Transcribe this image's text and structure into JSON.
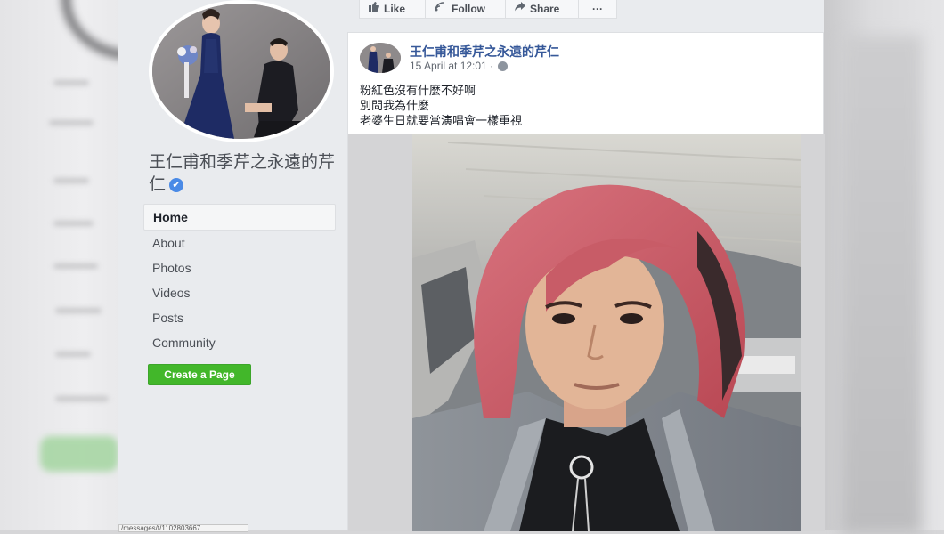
{
  "page": {
    "name": "王仁甫和季芹之永遠的芹仁",
    "verified": true
  },
  "nav": {
    "items": [
      {
        "label": "Home",
        "active": true
      },
      {
        "label": "About",
        "active": false
      },
      {
        "label": "Photos",
        "active": false
      },
      {
        "label": "Videos",
        "active": false
      },
      {
        "label": "Posts",
        "active": false
      },
      {
        "label": "Community",
        "active": false
      }
    ],
    "create_page_label": "Create a Page"
  },
  "actions": {
    "like_label": "Like",
    "follow_label": "Follow",
    "share_label": "Share",
    "more_label": "···"
  },
  "post": {
    "author": "王仁甫和季芹之永遠的芹仁",
    "timestamp": "15 April at 12:01 ·",
    "lines": [
      "粉紅色沒有什麼不好啊",
      "別問我為什麼",
      "老婆生日就要當演唱會一樣重視"
    ]
  },
  "status_bar": {
    "url": "/messages/t/1102803667"
  },
  "colors": {
    "link": "#365899",
    "create_button": "#42b72a",
    "verified": "#4a8ae6",
    "sidebar_bg": "#e9ebee"
  },
  "icons": [
    "like-icon",
    "follow-icon",
    "share-icon",
    "more-icon",
    "verified-icon",
    "globe-icon"
  ]
}
